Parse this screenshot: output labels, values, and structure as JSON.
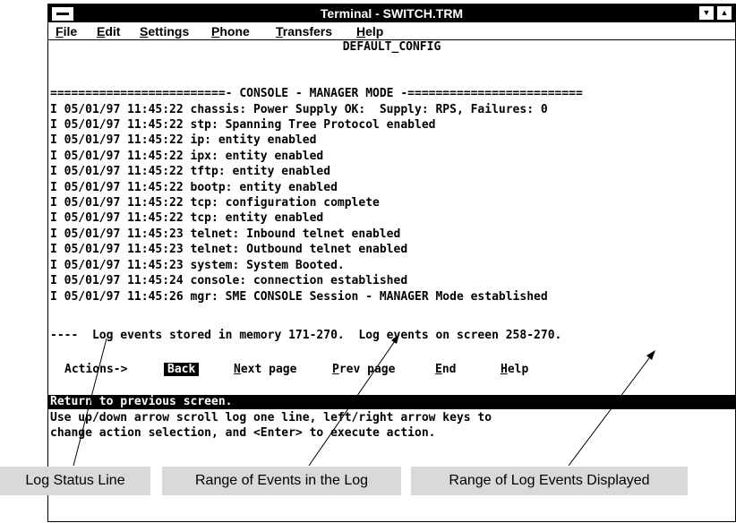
{
  "window": {
    "title": "Terminal - SWITCH.TRM",
    "config_name": "DEFAULT_CONFIG"
  },
  "menubar": {
    "items": [
      {
        "label": "File"
      },
      {
        "label": "Edit"
      },
      {
        "label": "Settings"
      },
      {
        "label": "Phone"
      },
      {
        "label": "Transfers"
      },
      {
        "label": "Help"
      }
    ]
  },
  "terminal": {
    "mode_header": "=========================- CONSOLE - MANAGER MODE -=========================",
    "log_lines": [
      "I 05/01/97 11:45:22 chassis: Power Supply OK:  Supply: RPS, Failures: 0",
      "I 05/01/97 11:45:22 stp: Spanning Tree Protocol enabled",
      "I 05/01/97 11:45:22 ip: entity enabled",
      "I 05/01/97 11:45:22 ipx: entity enabled",
      "I 05/01/97 11:45:22 tftp: entity enabled",
      "I 05/01/97 11:45:22 bootp: entity enabled",
      "I 05/01/97 11:45:22 tcp: configuration complete",
      "I 05/01/97 11:45:22 tcp: entity enabled",
      "I 05/01/97 11:45:23 telnet: Inbound telnet enabled",
      "I 05/01/97 11:45:23 telnet: Outbound telnet enabled",
      "I 05/01/97 11:45:23 system: System Booted.",
      "I 05/01/97 11:45:24 console: connection established",
      "I 05/01/97 11:45:26 mgr: SME CONSOLE Session - MANAGER Mode established"
    ],
    "status_line": "----  Log events stored in memory 171-270.  Log events on screen 258-270.",
    "actions_label": "Actions->",
    "actions": [
      {
        "label": "Back",
        "selected": true
      },
      {
        "label": "Next page"
      },
      {
        "label": "Prev page"
      },
      {
        "label": "End"
      },
      {
        "label": "Help"
      }
    ],
    "help_highlight": "Return to previous screen.",
    "help_lines": [
      "Use up/down arrow scroll log one line, left/right arrow keys to",
      "change action selection, and <Enter> to execute action."
    ]
  },
  "callouts": [
    {
      "label": "Log Status Line"
    },
    {
      "label": "Range of Events in the Log"
    },
    {
      "label": "Range of Log Events Displayed"
    }
  ]
}
